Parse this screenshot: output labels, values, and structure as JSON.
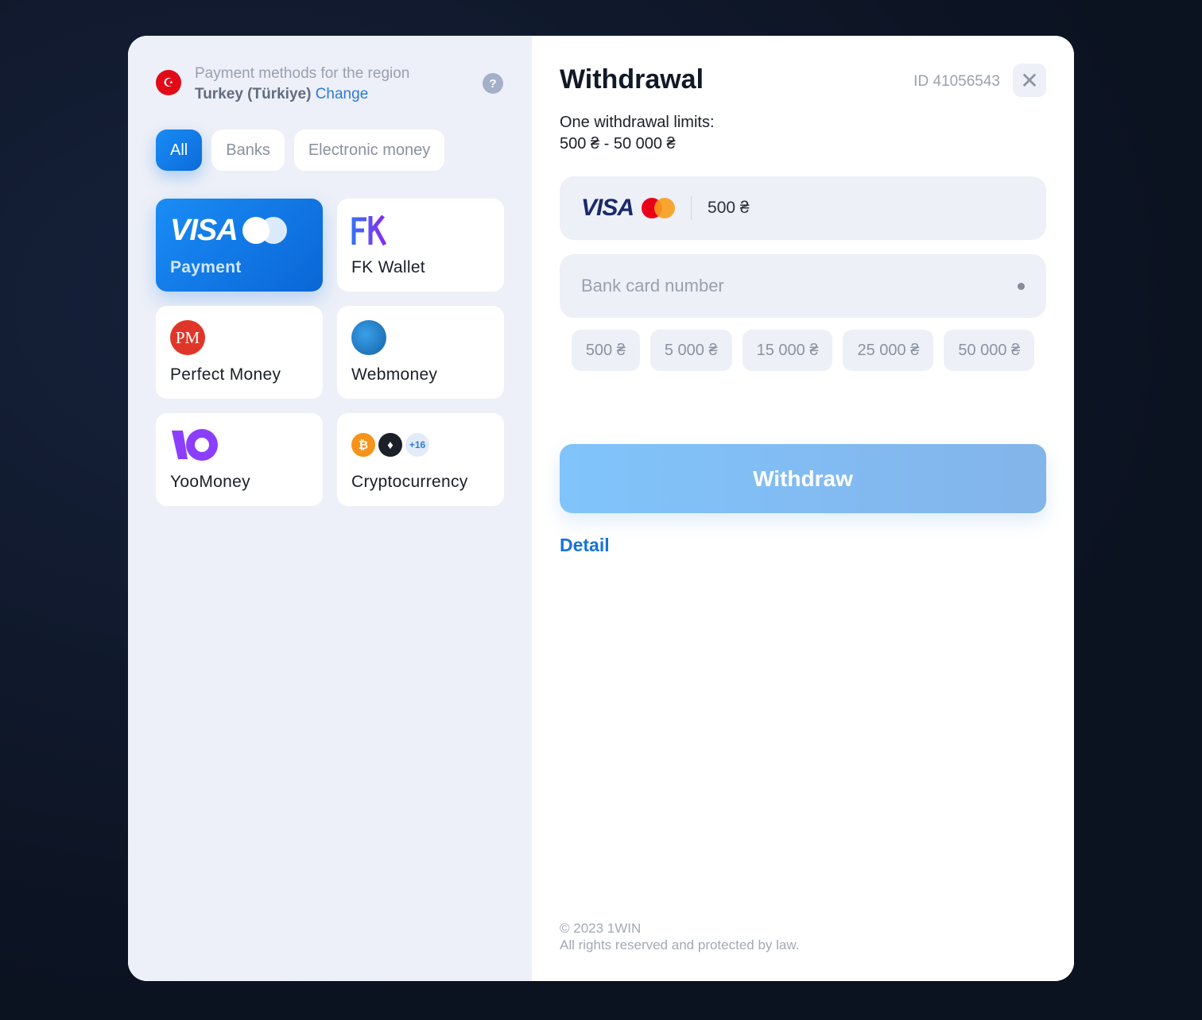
{
  "region": {
    "caption": "Payment methods for the region",
    "country": "Turkey (Türkiye)",
    "change": "Change",
    "help": "?",
    "flag_icon": "turkey-flag-icon"
  },
  "filters": [
    {
      "label": "All",
      "active": true
    },
    {
      "label": "Banks"
    },
    {
      "label": "Electronic money"
    }
  ],
  "methods": [
    {
      "name": "Payment",
      "logo": "visa-mastercard",
      "active": true
    },
    {
      "name": "FK Wallet",
      "logo": "fk-wallet"
    },
    {
      "name": "Perfect Money",
      "logo": "perfect-money",
      "logo_text": "PM"
    },
    {
      "name": "Webmoney",
      "logo": "webmoney"
    },
    {
      "name": "YooMoney",
      "logo": "yoomoney"
    },
    {
      "name": "Cryptocurrency",
      "logo": "crypto",
      "extra": "+16"
    }
  ],
  "withdrawal": {
    "title": "Withdrawal",
    "id": "ID 41056543",
    "limits_label": "One withdrawal limits:",
    "limits_range": "500 ₴ - 50 000 ₴",
    "card_logo": "VISA",
    "amount": "500 ₴",
    "card_placeholder": "Bank card number",
    "quick_amounts": [
      "500 ₴",
      "5 000 ₴",
      "15 000 ₴",
      "25 000 ₴",
      "50 000 ₴"
    ],
    "submit": "Withdraw",
    "detail": "Detail"
  },
  "footer": {
    "copyright": "© 2023 1WIN",
    "rights": "All rights reserved and protected by law."
  },
  "colors": {
    "accent": "#1580ec",
    "withdraw_button": "#80c4fb",
    "link": "#1672dc"
  }
}
